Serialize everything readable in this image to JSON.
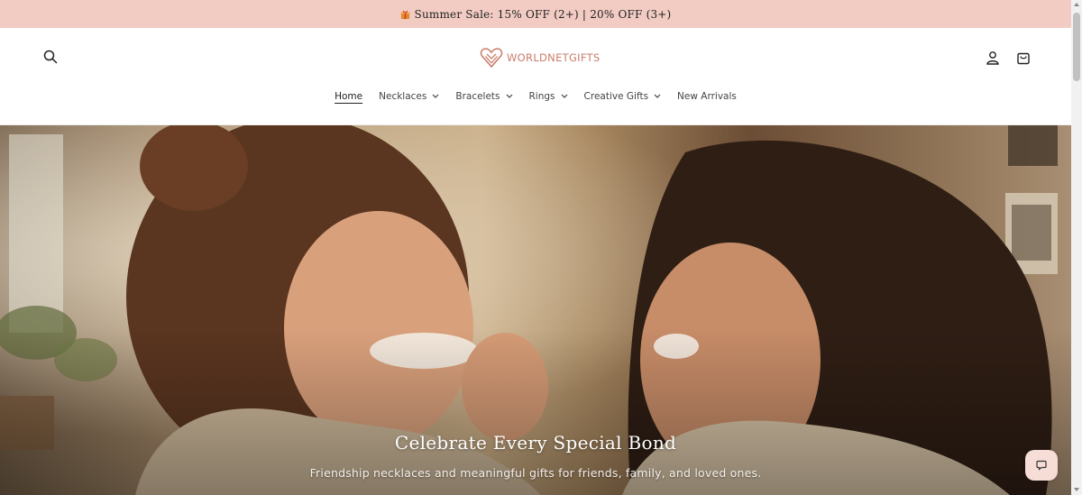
{
  "announcement": {
    "text": "Summer Sale: 15% OFF (2+) | 20% OFF (3+)",
    "icon": "gift-icon"
  },
  "header": {
    "logo_text": "WORLDNETGIFTS",
    "search_icon": "search-icon",
    "account_icon": "account-icon",
    "cart_icon": "cart-icon"
  },
  "nav": {
    "items": [
      {
        "label": "Home",
        "active": true,
        "dropdown": false
      },
      {
        "label": "Necklaces",
        "dropdown": true
      },
      {
        "label": "Bracelets",
        "dropdown": true
      },
      {
        "label": "Rings",
        "dropdown": true
      },
      {
        "label": "Creative Gifts",
        "dropdown": true
      },
      {
        "label": "New Arrivals",
        "dropdown": false
      }
    ]
  },
  "hero": {
    "title": "Celebrate Every Special Bond",
    "subtitle": "Friendship necklaces and meaningful gifts for friends, family, and loved ones."
  },
  "chat": {
    "icon": "chat-icon"
  },
  "colors": {
    "announcement_bg": "#f2ccc3",
    "brand": "#c97d6a"
  }
}
